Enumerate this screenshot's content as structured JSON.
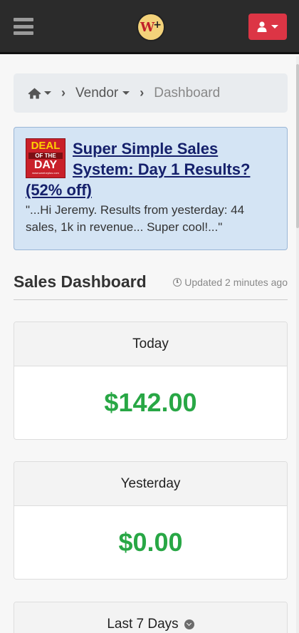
{
  "header": {
    "logo_text": "W+"
  },
  "breadcrumb": {
    "vendor": "Vendor",
    "current": "Dashboard"
  },
  "deal": {
    "badge_line1": "DEAL",
    "badge_line2": "OF THE",
    "badge_line3": "DAY",
    "badge_line4": "www.warriorplus.com",
    "title": "Super Simple Sales System: Day 1 Results? (52% off)",
    "quote": "\"...Hi Jeremy. Results from yesterday: 44 sales, 1k in revenue... Super cool!...\""
  },
  "dashboard": {
    "title": "Sales Dashboard",
    "updated": "Updated 2 minutes ago"
  },
  "cards": [
    {
      "label": "Today",
      "amount": "$142.00"
    },
    {
      "label": "Yesterday",
      "amount": "$0.00"
    },
    {
      "label": "Last 7 Days"
    }
  ],
  "colors": {
    "topbar": "#2b2b2b",
    "user_button": "#dc3545",
    "amount": "#28a745",
    "deal_bg": "#d4e4f4",
    "deal_title": "#15206b"
  },
  "icons": {
    "menu": "hamburger-icon",
    "user": "user-icon",
    "home": "home-icon",
    "clock": "clock-icon",
    "expand": "chevron-circle-down-icon"
  }
}
